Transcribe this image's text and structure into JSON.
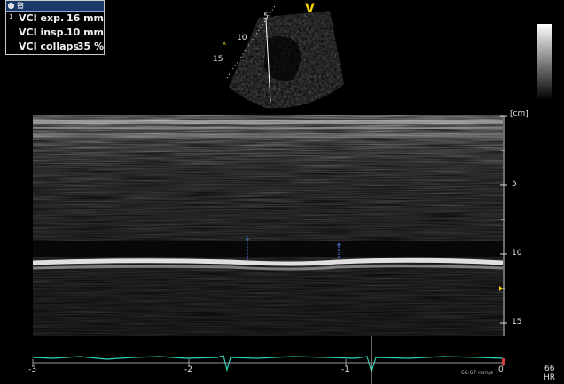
{
  "measurements": {
    "header_text": "暋",
    "items": [
      {
        "index": "1",
        "label": "VCI exp.",
        "value": "16 mm"
      },
      {
        "index": "",
        "label": "VCI insp.",
        "value": "10 mm"
      },
      {
        "index": "",
        "label": "VCI collaps",
        "value": "35 %"
      }
    ]
  },
  "sector": {
    "depth_labels": [
      "5",
      "10",
      "15"
    ],
    "orientation_marker": "V",
    "x_marker": "x"
  },
  "mmode": {
    "depth_unit_label": "[cm]",
    "depth_labels": [
      "5",
      "10",
      "15"
    ],
    "time_labels": [
      "-3",
      "-2",
      "-1",
      "0"
    ],
    "sweep_speed": "66.67 mm/s"
  },
  "hr": {
    "value": "66",
    "label": "HR"
  },
  "colors": {
    "ecg": "#2fd3b8",
    "caliper": "#5b8cff",
    "marker_yellow": "#f7d400",
    "panel_header": "#1b3a6a"
  }
}
